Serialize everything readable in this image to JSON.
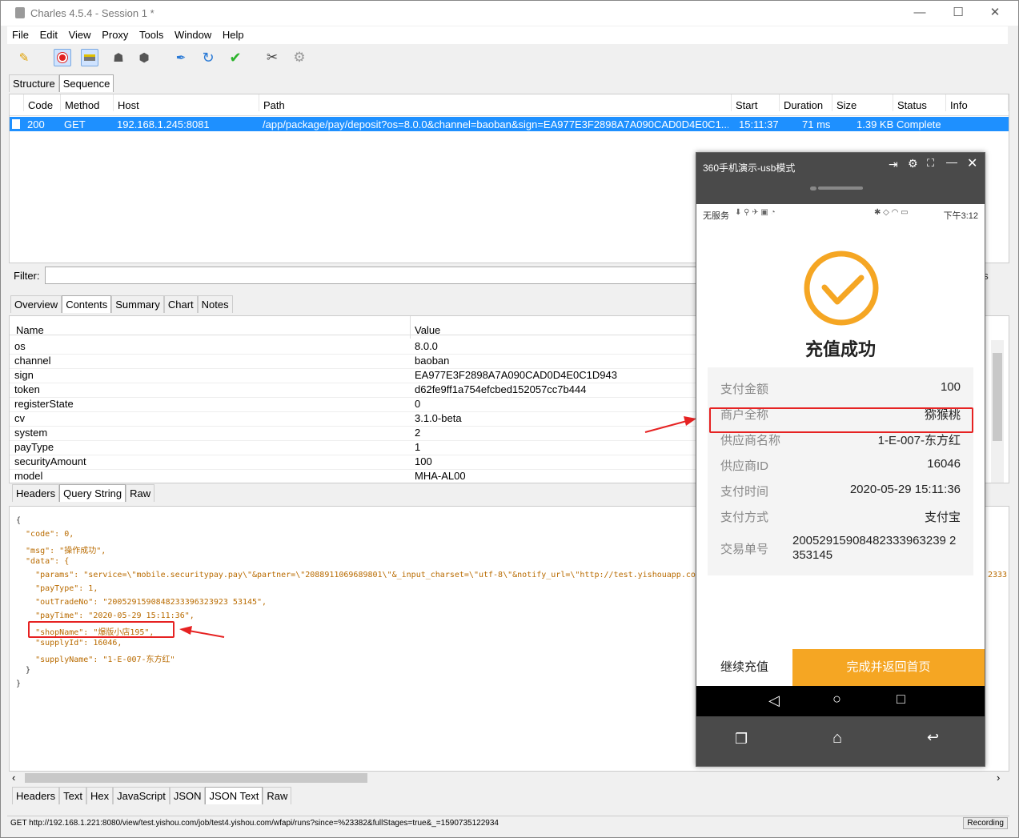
{
  "window": {
    "title": "Charles 4.5.4 - Session 1 *"
  },
  "menu": [
    "File",
    "Edit",
    "View",
    "Proxy",
    "Tools",
    "Window",
    "Help"
  ],
  "toolbar_icons": [
    "broom-icon",
    "record-icon",
    "throttle-icon",
    "turtle-icon",
    "stop-icon",
    "pen-icon",
    "refresh-icon",
    "check-icon",
    "tools-icon",
    "gear-icon"
  ],
  "view_tabs": [
    "Structure",
    "Sequence"
  ],
  "sequence": {
    "columns": [
      "Code",
      "Method",
      "Host",
      "Path",
      "Start",
      "Duration",
      "Size",
      "Status",
      "Info"
    ],
    "row": {
      "code": "200",
      "method": "GET",
      "host": "192.168.1.245:8081",
      "path": "/app/package/pay/deposit?os=8.0.0&channel=baoban&sign=EA977E3F2898A7A090CAD0D4E0C1...",
      "start": "15:11:37",
      "duration": "71 ms",
      "size": "1.39 KB",
      "status": "Complete",
      "info": ""
    }
  },
  "filter": {
    "label": "Filter:",
    "trailing": "gs"
  },
  "detail_tabs": [
    "Overview",
    "Contents",
    "Summary",
    "Chart",
    "Notes"
  ],
  "params": {
    "headers": [
      "Name",
      "Value"
    ],
    "rows": [
      [
        "os",
        "8.0.0"
      ],
      [
        "channel",
        "baoban"
      ],
      [
        "sign",
        "EA977E3F2898A7A090CAD0D4E0C1D943"
      ],
      [
        "token",
        "d62fe9ff1a754efcbed152057cc7b444"
      ],
      [
        "registerState",
        "0"
      ],
      [
        "cv",
        "3.1.0-beta"
      ],
      [
        "system",
        "2"
      ],
      [
        "payType",
        "1"
      ],
      [
        "securityAmount",
        "100"
      ],
      [
        "model",
        "MHA-AL00"
      ]
    ]
  },
  "request_tabs": [
    "Headers",
    "Query String",
    "Raw"
  ],
  "json_lines": [
    "{",
    "  \"code\": 0,",
    "  \"msg\": \"操作成功\",",
    "  \"data\": {",
    "    \"params\": \"service=\\\"mobile.securitypay.pay\\\"&partner=\\\"2088911069689801\\\"&_input_charset=\\\"utf-8\\\"&notify_url=\\\"http://test.yishouapp.com",
    "    \"payType\": 1,",
    "    \"outTradeNo\": \"2005291590848233396323923 53145\",",
    "    \"payTime\": \"2020-05-29 15:11:36\",",
    "    \"shopName\": \"爆版小店195\",",
    "    \"supplyId\": 16046,",
    "    \"supplyName\": \"1-E-007-东方红\"",
    "  }",
    "}"
  ],
  "json_right_fragment": "2333",
  "response_tabs": [
    "Headers",
    "Text",
    "Hex",
    "JavaScript",
    "JSON",
    "JSON Text",
    "Raw"
  ],
  "statusbar": {
    "url": "GET http://192.168.1.221:8080/view/test.yishou.com/job/test4.yishou.com/wfapi/runs?since=%23382&fullStages=true&_=1590735122934",
    "recording": "Recording"
  },
  "phone": {
    "title": "360手机演示-usb模式",
    "carrier": "无服务",
    "time": "下午3:12",
    "success_text": "充值成功",
    "rows": [
      {
        "label": "支付金额",
        "value": "100"
      },
      {
        "label": "商户全称",
        "value": "猕猴桃"
      },
      {
        "label": "供应商名称",
        "value": "1-E-007-东方红"
      },
      {
        "label": "供应商ID",
        "value": "16046"
      },
      {
        "label": "支付时间",
        "value": "2020-05-29 15:11:36"
      },
      {
        "label": "支付方式",
        "value": "支付宝"
      },
      {
        "label": "交易单号",
        "value": "20052915908482333963239 2353145"
      }
    ],
    "btn_continue": "继续充值",
    "btn_done": "完成并返回首页",
    "accent": "#f5a623"
  }
}
